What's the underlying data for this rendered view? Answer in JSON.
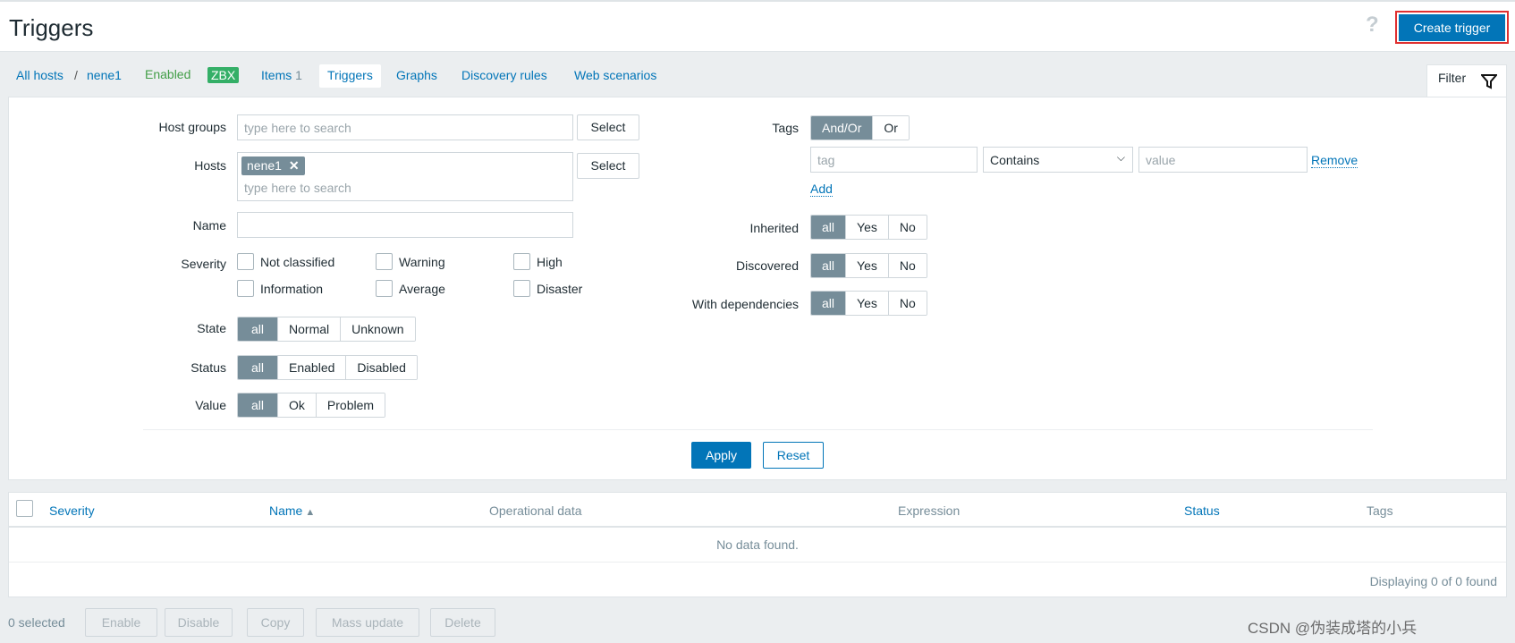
{
  "header": {
    "title": "Triggers",
    "help_icon": "question-icon",
    "create_button": "Create trigger",
    "accent": "#0275b8"
  },
  "nav": {
    "all_hosts": "All hosts",
    "separator": "/",
    "host": "nene1",
    "enabled": "Enabled",
    "zbx": "ZBX",
    "items": "Items",
    "items_count": "1",
    "triggers": "Triggers",
    "graphs": "Graphs",
    "discovery": "Discovery rules",
    "web": "Web scenarios"
  },
  "filter": {
    "tab": "Filter",
    "host_groups_label": "Host groups",
    "host_groups_placeholder": "type here to search",
    "select": "Select",
    "hosts_label": "Hosts",
    "host_chip": "nene1",
    "hosts_placeholder": "type here to search",
    "name_label": "Name",
    "name_value": "",
    "severity_label": "Severity",
    "severities": [
      "Not classified",
      "Warning",
      "High",
      "Information",
      "Average",
      "Disaster"
    ],
    "state_label": "State",
    "state_options": [
      "all",
      "Normal",
      "Unknown"
    ],
    "status_label": "Status",
    "status_options": [
      "all",
      "Enabled",
      "Disabled"
    ],
    "value_label": "Value",
    "value_options": [
      "all",
      "Ok",
      "Problem"
    ],
    "tags_label": "Tags",
    "tags_options": [
      "And/Or",
      "Or"
    ],
    "tag_placeholder": "tag",
    "operator": "Contains",
    "value_placeholder": "value",
    "remove": "Remove",
    "add": "Add",
    "inherited_label": "Inherited",
    "discovered_label": "Discovered",
    "deps_label": "With dependencies",
    "yesno": [
      "all",
      "Yes",
      "No"
    ],
    "apply": "Apply",
    "reset": "Reset"
  },
  "table": {
    "columns": [
      "Severity",
      "Name",
      "Operational data",
      "Expression",
      "Status",
      "Tags"
    ],
    "sort_indicator": "▲",
    "empty": "No data found.",
    "displaying": "Displaying 0 of 0 found"
  },
  "footer": {
    "selected": "0 selected",
    "buttons": [
      "Enable",
      "Disable",
      "Copy",
      "Mass update",
      "Delete"
    ]
  },
  "watermark": "CSDN @伪装成塔的小兵"
}
